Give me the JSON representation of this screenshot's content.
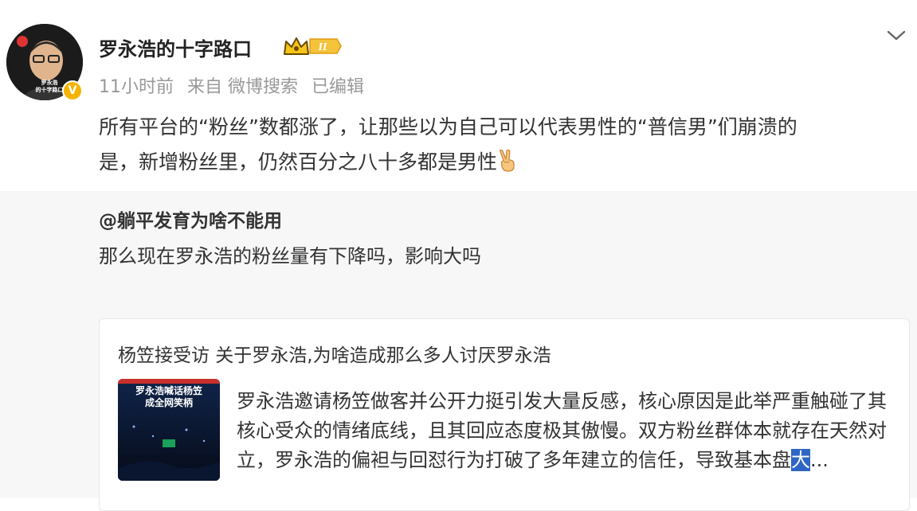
{
  "post": {
    "username": "罗永浩的十字路口",
    "badge": "II",
    "avatar_caption_line1": "罗永浩",
    "avatar_caption_line2": "的十字路口",
    "verify_mark": "V",
    "time": "11小时前",
    "source": "来自 微博搜索",
    "edited": "已编辑",
    "text_line1": "所有平台的“粉丝”数都涨了，让那些以为自己可以代表男性的“普信男”们崩溃的",
    "text_line2": "是，新增粉丝里，仍然百分之八十多都是男性",
    "emoji": "victory-hand"
  },
  "repost": {
    "author": "@躺平发育为啥不能用",
    "text": "那么现在罗永浩的粉丝量有下降吗，影响大吗"
  },
  "card": {
    "title": "杨笠接受访 关于罗永浩,为啥造成那么多人讨厌罗永浩",
    "thumb_title_line1": "罗永浩喊话杨笠",
    "thumb_title_line2": "成全网笑柄",
    "summary_main": "罗永浩邀请杨笠做客并公开力挺引发大量反感，核心原因是此举严重触碰了其核心受众的情绪底线，且其回应态度极其傲慢。双方粉丝群体本就存在天然对立，罗永浩的偏袒与回怼行为打破了多年建立的信任，导致基本盘",
    "summary_highlight": "大",
    "summary_ellipsis": "..."
  },
  "colors": {
    "meta_gray": "#999999",
    "repost_bg": "#f7f7f7",
    "verify_gold": "#f4b400",
    "highlight_blue": "#2f66c6"
  }
}
